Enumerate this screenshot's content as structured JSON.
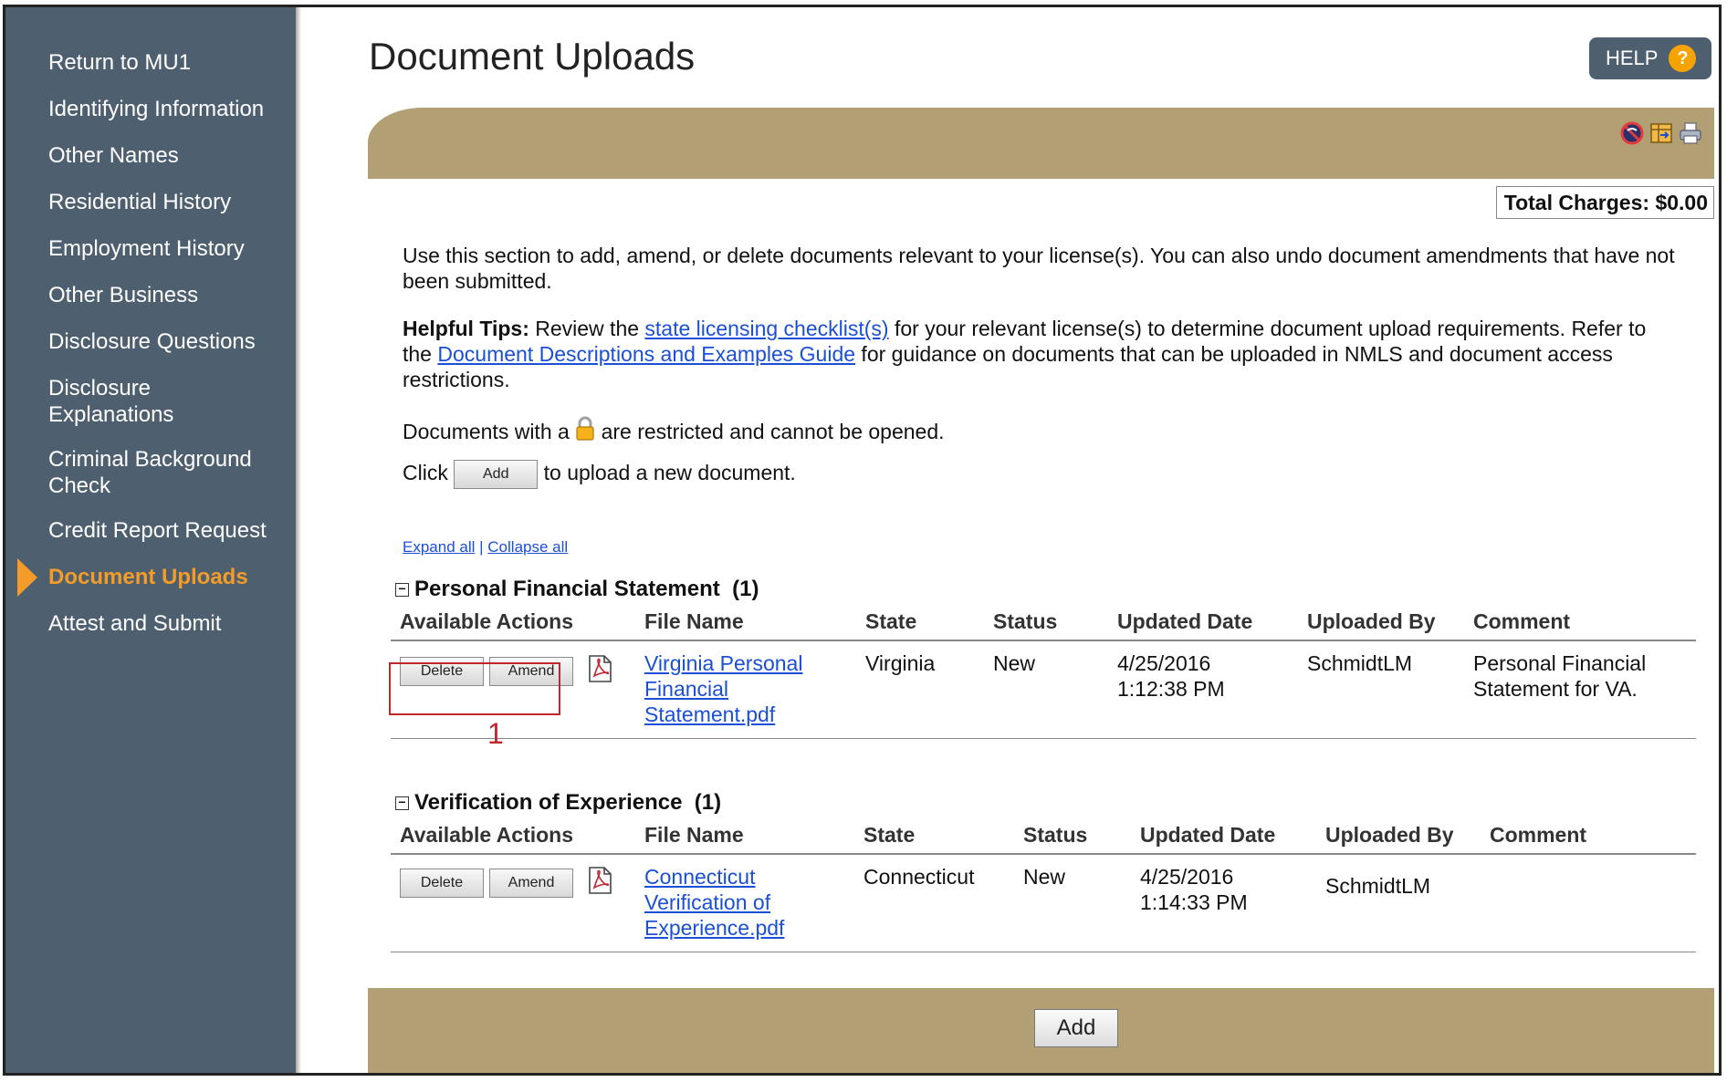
{
  "sidebar": {
    "items": [
      {
        "label": "Return to MU1"
      },
      {
        "label": "Identifying Information"
      },
      {
        "label": "Other Names"
      },
      {
        "label": "Residential History"
      },
      {
        "label": "Employment History"
      },
      {
        "label": "Other Business"
      },
      {
        "label": "Disclosure Questions"
      },
      {
        "label": "Disclosure Explanations"
      },
      {
        "label": "Criminal Background Check"
      },
      {
        "label": "Credit Report Request"
      },
      {
        "label": "Document Uploads",
        "active": true
      },
      {
        "label": "Attest and Submit"
      }
    ],
    "active_color": "#f39c2a",
    "background": "#4e5f70"
  },
  "header": {
    "title": "Document Uploads",
    "help_label": "HELP",
    "help_icon": "?"
  },
  "toolbar_icons": [
    "no-entry-icon",
    "export-icon",
    "print-icon"
  ],
  "total_charges": "Total Charges: $0.00",
  "intro": {
    "text": "Use this section to add, amend, or delete documents relevant to your license(s). You can also undo document amendments that have not been submitted.",
    "tips_label": "Helpful Tips:",
    "tips_pre": " Review the ",
    "tips_link1": "state licensing checklist(s)",
    "tips_mid": " for your relevant license(s) to determine document upload requirements. Refer to the ",
    "tips_link2": "Document Descriptions and Examples Guide",
    "tips_post": " for guidance on documents that can be uploaded in NMLS and document access restrictions.",
    "restricted_pre": "Documents with a",
    "restricted_post": "are restricted and cannot be opened.",
    "click_pre": "Click",
    "click_btn": "Add",
    "click_post": "to upload a new document."
  },
  "expand_all": "Expand all",
  "link_separator": "|",
  "collapse_all": "Collapse all",
  "columns": [
    "Available Actions",
    "File Name",
    "State",
    "Status",
    "Updated Date",
    "Uploaded By",
    "Comment"
  ],
  "sections": [
    {
      "title": "Personal Financial Statement",
      "count": "(1)",
      "rows": [
        {
          "delete_label": "Delete",
          "amend_label": "Amend",
          "file_name": "Virginia Personal Financial Statement.pdf",
          "state": "Virginia",
          "status": "New",
          "updated_date": "4/25/2016",
          "updated_time": "1:12:38 PM",
          "uploaded_by": "SchmidtLM",
          "comment": "Personal Financial Statement for VA."
        }
      ]
    },
    {
      "title": "Verification of Experience",
      "count": "(1)",
      "rows": [
        {
          "delete_label": "Delete",
          "amend_label": "Amend",
          "file_name": "Connecticut Verification of Experience.pdf",
          "state": "Connecticut",
          "status": "New",
          "updated_date": "4/25/2016",
          "updated_time": "1:14:33 PM",
          "uploaded_by": "SchmidtLM",
          "comment": ""
        }
      ]
    }
  ],
  "callout_number": "1",
  "add_button": "Add",
  "colors": {
    "panel_tan": "#b29f74",
    "link_blue": "#1a4fd6",
    "callout_red": "#c0272d",
    "help_orange": "#f5a300"
  }
}
